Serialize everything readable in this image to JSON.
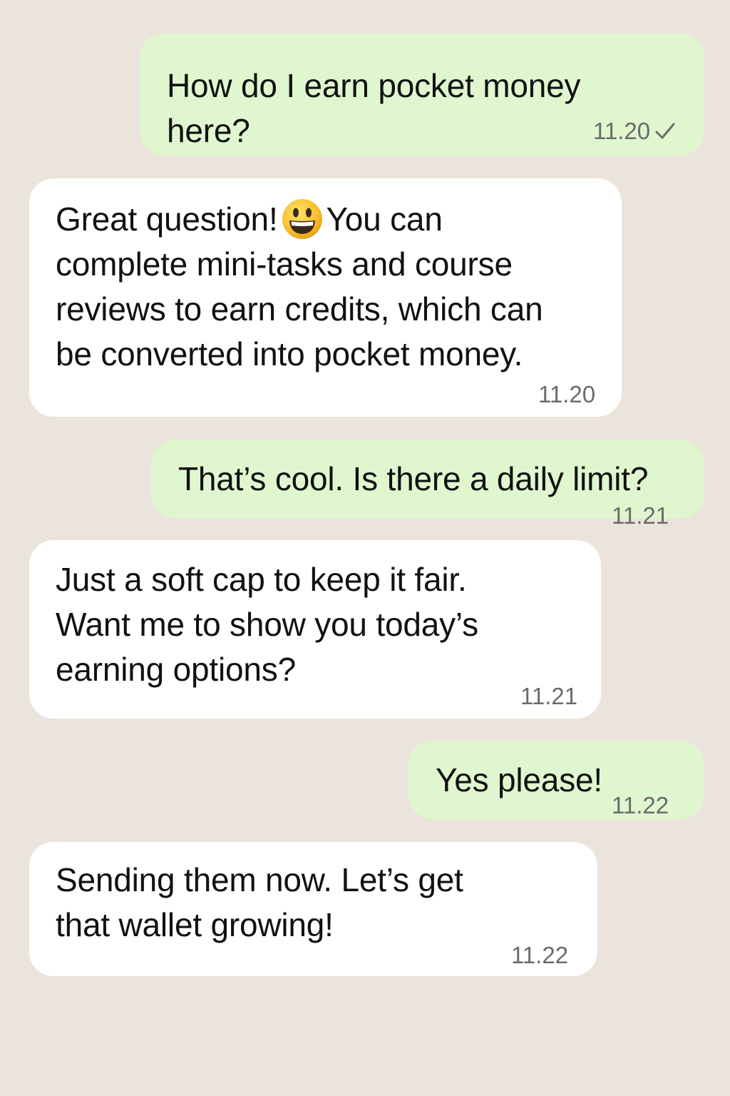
{
  "colors": {
    "background": "#ebe4dd",
    "outgoing_bubble": "#e0f6cf",
    "incoming_bubble": "#ffffff",
    "timestamp": "#6b6b6b",
    "text": "#111111"
  },
  "chat": {
    "messages": [
      {
        "direction": "outgoing",
        "lines": [
          "How do I earn pocket money",
          "here?"
        ],
        "time": "11.20",
        "status_icon": "check-icon"
      },
      {
        "direction": "incoming",
        "lines_before_emoji": "Great question!",
        "emoji": "grinning-face-icon",
        "lines_after_emoji": "You can",
        "lines": [
          "complete mini-tasks and course",
          "reviews to earn credits, which can",
          "be converted into pocket money."
        ],
        "time": "11.20"
      },
      {
        "direction": "outgoing",
        "lines": [
          "That’s cool. Is there a daily limit?"
        ],
        "time": "11.21"
      },
      {
        "direction": "incoming",
        "lines": [
          "Just a soft cap to keep it fair.",
          "Want me to show you today’s",
          "earning options?"
        ],
        "time": "11.21"
      },
      {
        "direction": "outgoing",
        "lines": [
          "Yes please!"
        ],
        "time": "11.22"
      },
      {
        "direction": "incoming",
        "lines": [
          "Sending them now. Let’s get",
          "that wallet growing!"
        ],
        "time": "11.22"
      }
    ]
  }
}
